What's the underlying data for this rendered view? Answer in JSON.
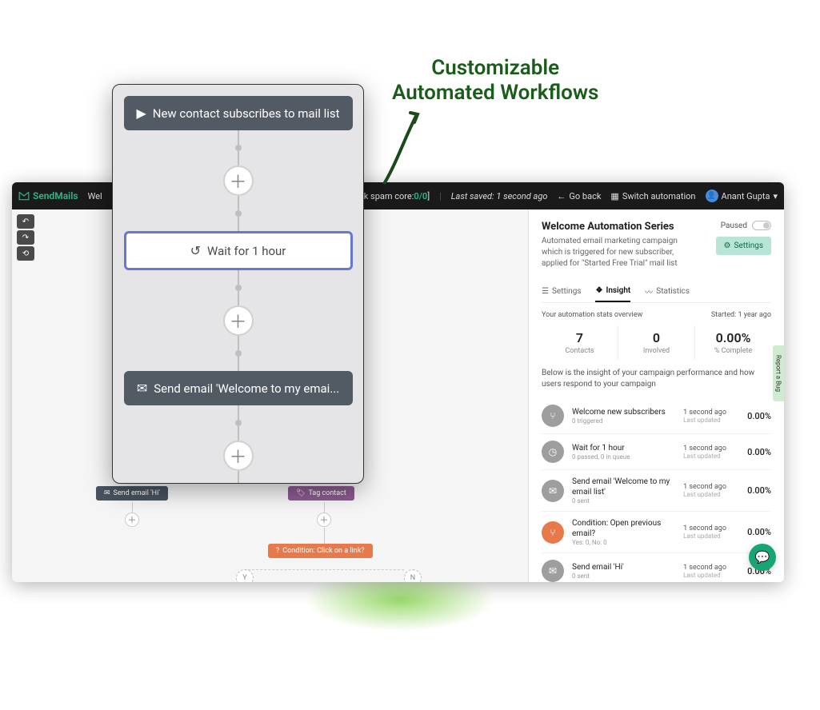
{
  "annotation": {
    "line1": "Customizable",
    "line2": "Automated Workflows"
  },
  "topbar": {
    "logo": "SendMails",
    "welcome_prefix": "Wel",
    "spam_label": "[Check spam",
    "spam_score_label": "core:",
    "spam_score": "0/0",
    "spam_close": "]",
    "last_saved": "Last saved: 1 second ago",
    "go_back": "Go back",
    "switch": "Switch automation",
    "user": "Anant Gupta"
  },
  "popup_nodes": {
    "trigger": "New contact subscribes to mail list",
    "wait": "Wait for 1 hour",
    "send": "Send email 'Welcome to my emai...",
    "condition": "Condition: Open previous email?"
  },
  "flow_lower": {
    "left": "Send email 'Hi'",
    "right": "Tag contact",
    "condition2": "Condition: Click on a link?",
    "yes": "Y",
    "no": "N"
  },
  "right_panel": {
    "title": "Welcome Automation Series",
    "desc": "Automated email marketing campaign which is triggered for new subscriber, applied for \"Started Free Trial\" mail list",
    "paused": "Paused",
    "settings_btn": "Settings",
    "tabs": {
      "settings": "Settings",
      "insight": "Insight",
      "statistics": "Statistics"
    },
    "overview_label": "Your automation stats overview",
    "started": "Started: 1 year ago",
    "metrics": {
      "contacts_v": "7",
      "contacts_l": "Contacts",
      "involved_v": "0",
      "involved_l": "Involved",
      "complete_v": "0.00%",
      "complete_l": "% Complete"
    },
    "insight_desc": "Below is the insight of your campaign performance and how users respond to your campaign",
    "items": [
      {
        "name": "Welcome new subscribers",
        "sub": "0 triggered",
        "mid": "1 second ago",
        "mid2": "Last updated",
        "pct": "0.00%",
        "color": "gray",
        "glyph": "⑂"
      },
      {
        "name": "Wait for 1 hour",
        "sub": "0 passed, 0 in queue",
        "mid": "1 second ago",
        "mid2": "Last updated",
        "pct": "0.00%",
        "color": "gray",
        "glyph": "◷"
      },
      {
        "name": "Send email 'Welcome to my email list'",
        "sub": "0 sent",
        "mid": "1 second ago",
        "mid2": "Last updated",
        "pct": "0.00%",
        "color": "gray",
        "glyph": "✉"
      },
      {
        "name": "Condition: Open previous email?",
        "sub": "Yes: 0, No: 0",
        "mid": "1 second ago",
        "mid2": "Last updated",
        "pct": "0.00%",
        "color": "orange",
        "glyph": "⑂"
      },
      {
        "name": "Send email 'Hi'",
        "sub": "0 sent",
        "mid": "1 second ago",
        "mid2": "Last updated",
        "pct": "0.00%",
        "color": "gray",
        "glyph": "✉"
      }
    ],
    "bug_tab": "Report a Bug"
  }
}
